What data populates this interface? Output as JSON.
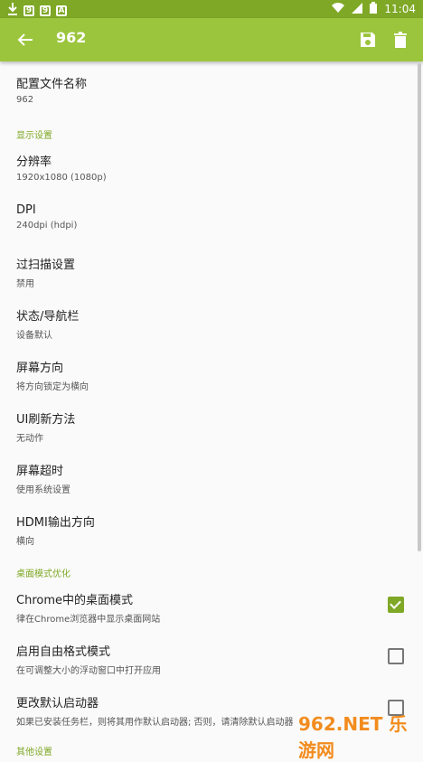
{
  "status_bar": {
    "time": "11:04",
    "icons_left": [
      "download-icon",
      "app-icon-9",
      "app-icon-9",
      "app-icon-a"
    ],
    "icons_right": [
      "wifi-icon",
      "signal-icon",
      "battery-icon"
    ]
  },
  "appbar": {
    "title": "962"
  },
  "profile": {
    "label": "配置文件名称",
    "value": "962"
  },
  "display_section": "显示设置",
  "settings": [
    {
      "title": "分辨率",
      "subtitle": "1920x1080 (1080p)"
    },
    {
      "title": "DPI",
      "subtitle": "240dpi (hdpi)"
    },
    {
      "title": "过扫描设置",
      "subtitle": "禁用"
    },
    {
      "title": "状态/导航栏",
      "subtitle": "设备默认"
    },
    {
      "title": "屏幕方向",
      "subtitle": "将方向锁定为横向"
    },
    {
      "title": "UI刷新方法",
      "subtitle": "无动作"
    },
    {
      "title": "屏幕超时",
      "subtitle": "使用系统设置"
    },
    {
      "title": "HDMI输出方向",
      "subtitle": "横向"
    }
  ],
  "desktop_section": "桌面模式优化",
  "toggles": [
    {
      "title": "Chrome中的桌面模式",
      "subtitle": "律在Chrome浏览器中显示桌面网站",
      "checked": true
    },
    {
      "title": "启用自由格式模式",
      "subtitle": "在可调整大小的浮动窗口中打开应用",
      "checked": false
    },
    {
      "title": "更改默认启动器",
      "subtitle": "如果已安装任务栏，则将其用作默认启动器; 否则，请清除默认启动器",
      "checked": false
    }
  ],
  "other_section": "其他设置",
  "watermark": "962.NET 乐游网",
  "colors": {
    "appbar": "#9bc53d",
    "accent": "#7fa826"
  }
}
